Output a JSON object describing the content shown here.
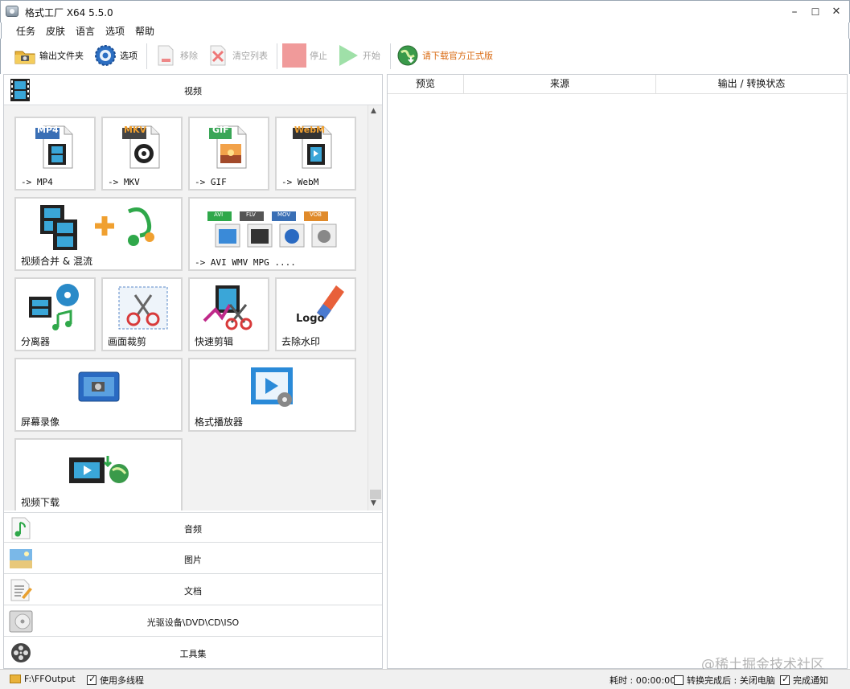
{
  "window": {
    "title": "格式工厂 X64 5.5.0",
    "minimize": "–",
    "maximize": "☐",
    "close": "✕"
  },
  "menu": [
    "任务",
    "皮肤",
    "语言",
    "选项",
    "帮助"
  ],
  "toolbar": {
    "output_folder": "输出文件夹",
    "options": "选项",
    "remove": "移除",
    "clear_list": "清空列表",
    "stop": "停止",
    "start": "开始",
    "download": "请下载官方正式版"
  },
  "categories": {
    "video": "视频",
    "audio": "音频",
    "picture": "图片",
    "document": "文档",
    "optical": "光驱设备\\DVD\\CD\\ISO",
    "tools": "工具集"
  },
  "tiles": {
    "mp4": {
      "badge": "MP4",
      "label": "-> MP4"
    },
    "mkv": {
      "badge": "MKV",
      "label": "-> MKV"
    },
    "gif": {
      "badge": "GIF",
      "label": "-> GIF"
    },
    "webm": {
      "badge": "WebM",
      "label": "-> WebM"
    },
    "merge": {
      "label": "视频合并 & 混流"
    },
    "avi": {
      "badges": [
        "AVI",
        "FLV",
        "MOV",
        "VOB"
      ],
      "label": "-> AVI WMV MPG ...."
    },
    "splitter": {
      "label": "分离器"
    },
    "crop": {
      "label": "画面裁剪"
    },
    "quick_cut": {
      "label": "快速剪辑"
    },
    "watermark": {
      "label": "去除水印",
      "logo_text": "Logo"
    },
    "screen_record": {
      "label": "屏幕录像"
    },
    "player": {
      "label": "格式播放器"
    },
    "download": {
      "label": "视频下载"
    }
  },
  "table": {
    "columns": [
      "预览",
      "来源",
      "输出 / 转换状态"
    ]
  },
  "statusbar": {
    "output_path": "F:\\FFOutput",
    "multithread": "使用多线程",
    "multithread_checked": true,
    "elapsed": "耗时 : 00:00:00",
    "after_convert": "转换完成后 : 关闭电脑",
    "after_convert_checked": false,
    "notify": "完成通知",
    "notify_checked": true
  },
  "overlay_watermark": "@稀土掘金技术社区",
  "colors": {
    "accent_green": "#3cbf5a",
    "stop_red": "#f09a9a",
    "download_orange": "#d96a12",
    "mp4_badge": "#3a6fb5",
    "mkv_badge": "#444444",
    "gif_badge": "#3aa657",
    "webm_badge": "#333333"
  }
}
